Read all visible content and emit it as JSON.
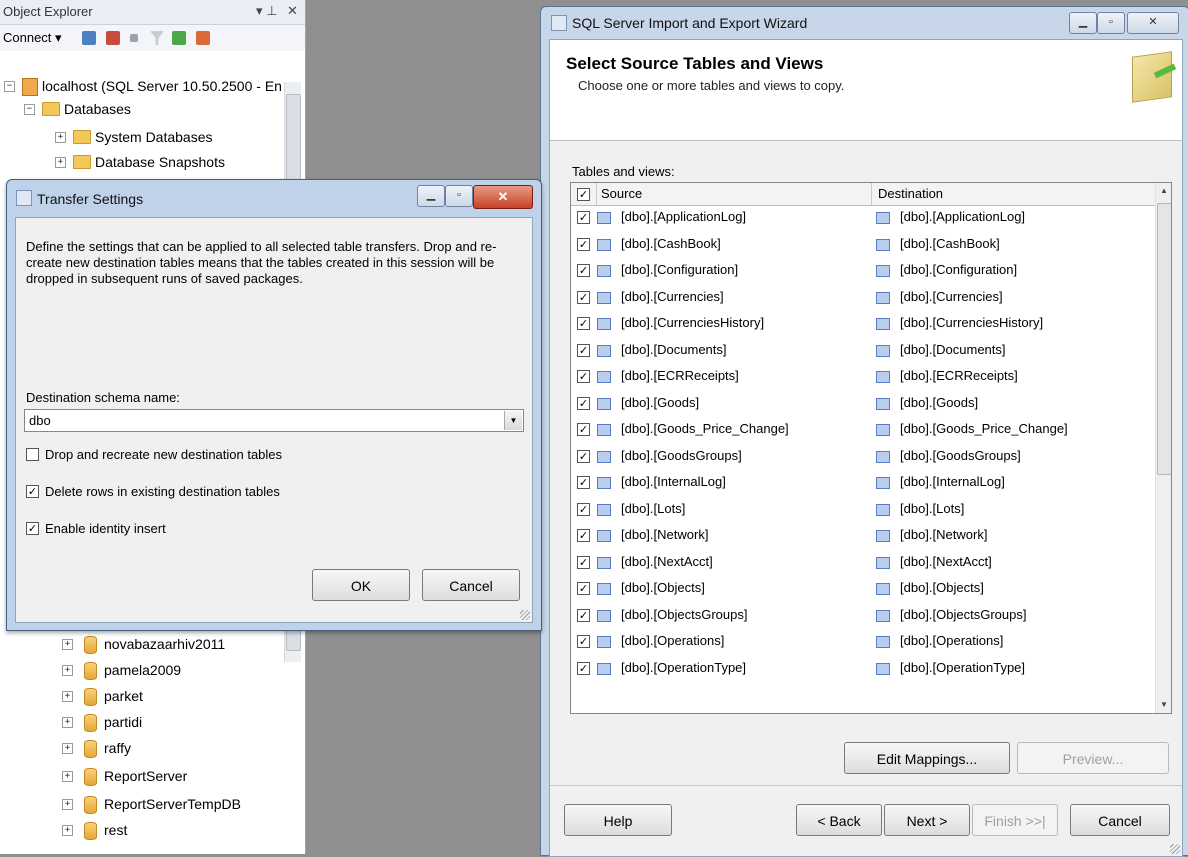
{
  "object_explorer": {
    "title": "Object Explorer",
    "pin": "▾ ⅌",
    "close": "✕",
    "connect_label": "Connect ▾",
    "server_node": "localhost (SQL Server 10.50.2500 - En",
    "databases_node": "Databases",
    "system_databases": "System Databases",
    "database_snapshots": "Database Snapshots",
    "dbs": [
      "novabazaarhiv2011",
      "pamela2009",
      "parket",
      "partidi",
      "raffy",
      "ReportServer",
      "ReportServerTempDB",
      "rest"
    ]
  },
  "wizard": {
    "title": "SQL Server Import and Export Wizard",
    "heading": "Select Source Tables and Views",
    "subheading": "Choose one or more tables and views to copy.",
    "tables_label": "Tables and views:",
    "col_source": "Source",
    "col_destination": "Destination",
    "header_checked": "✓",
    "rows": [
      {
        "source": "[dbo].[ApplicationLog]",
        "dest": "[dbo].[ApplicationLog]",
        "checked": "✓"
      },
      {
        "source": "[dbo].[CashBook]",
        "dest": "[dbo].[CashBook]",
        "checked": "✓"
      },
      {
        "source": "[dbo].[Configuration]",
        "dest": "[dbo].[Configuration]",
        "checked": "✓"
      },
      {
        "source": "[dbo].[Currencies]",
        "dest": "[dbo].[Currencies]",
        "checked": "✓"
      },
      {
        "source": "[dbo].[CurrenciesHistory]",
        "dest": "[dbo].[CurrenciesHistory]",
        "checked": "✓"
      },
      {
        "source": "[dbo].[Documents]",
        "dest": "[dbo].[Documents]",
        "checked": "✓"
      },
      {
        "source": "[dbo].[ECRReceipts]",
        "dest": "[dbo].[ECRReceipts]",
        "checked": "✓"
      },
      {
        "source": "[dbo].[Goods]",
        "dest": "[dbo].[Goods]",
        "checked": "✓"
      },
      {
        "source": "[dbo].[Goods_Price_Change]",
        "dest": "[dbo].[Goods_Price_Change]",
        "checked": "✓"
      },
      {
        "source": "[dbo].[GoodsGroups]",
        "dest": "[dbo].[GoodsGroups]",
        "checked": "✓"
      },
      {
        "source": "[dbo].[InternalLog]",
        "dest": "[dbo].[InternalLog]",
        "checked": "✓"
      },
      {
        "source": "[dbo].[Lots]",
        "dest": "[dbo].[Lots]",
        "checked": "✓"
      },
      {
        "source": "[dbo].[Network]",
        "dest": "[dbo].[Network]",
        "checked": "✓"
      },
      {
        "source": "[dbo].[NextAcct]",
        "dest": "[dbo].[NextAcct]",
        "checked": "✓"
      },
      {
        "source": "[dbo].[Objects]",
        "dest": "[dbo].[Objects]",
        "checked": "✓"
      },
      {
        "source": "[dbo].[ObjectsGroups]",
        "dest": "[dbo].[ObjectsGroups]",
        "checked": "✓"
      },
      {
        "source": "[dbo].[Operations]",
        "dest": "[dbo].[Operations]",
        "checked": "✓"
      },
      {
        "source": "[dbo].[OperationType]",
        "dest": "[dbo].[OperationType]",
        "checked": "✓"
      }
    ],
    "edit_mappings": "Edit Mappings...",
    "preview": "Preview...",
    "help": "Help",
    "back": "< Back",
    "next": "Next >",
    "finish": "Finish >>|",
    "cancel": "Cancel"
  },
  "transfer_settings": {
    "title": "Transfer Settings",
    "description": "Define the settings that can be applied to all selected table transfers. Drop and re-create new destination tables means that the tables created in this session will be dropped in subsequent runs of saved packages.",
    "schema_label": "Destination schema name:",
    "schema_value": "dbo",
    "drop_recreate": {
      "label": "Drop and recreate new destination tables",
      "mark": ""
    },
    "delete_rows": {
      "label": "Delete rows in existing destination tables",
      "mark": "✓"
    },
    "identity_insert": {
      "label": "Enable identity insert",
      "mark": "✓"
    },
    "ok": "OK",
    "cancel": "Cancel"
  }
}
